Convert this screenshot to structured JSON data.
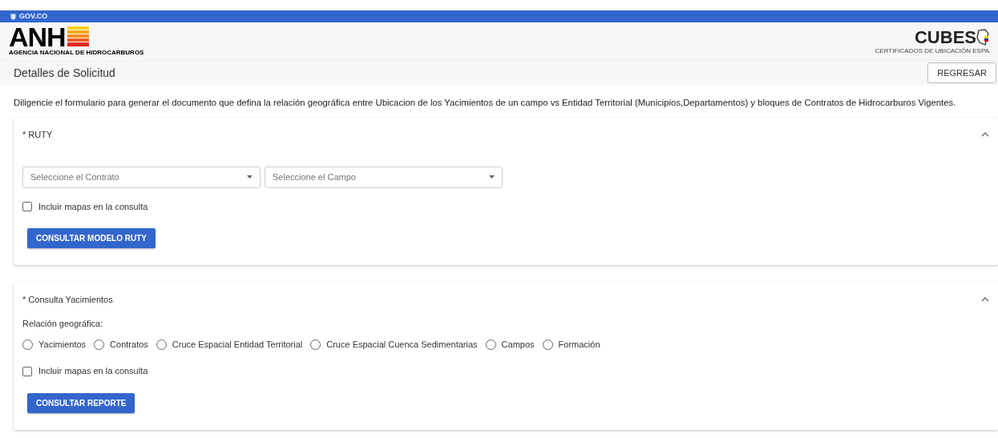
{
  "gov_bar": {
    "label": "GOV.CO"
  },
  "header": {
    "logo_left": {
      "text": "ANH",
      "subtitle": "AGENCIA NACIONAL DE HIDROCARBUROS"
    },
    "logo_right": {
      "text": "CUBES",
      "subtitle": "CERTIFICADOS DE UBICACIÓN ESPA"
    }
  },
  "title_bar": {
    "title": "Detalles de Solicitud",
    "button": "REGRESAR"
  },
  "description": "Diligencie el formulario para generar el documento que defina la relación geográfica entre Ubicacion de los Yacimientos de un campo vs Entidad Territorial (Municipios,Departamentos) y bloques de Contratos de Hidrocarburos Vigentes.",
  "panels": [
    {
      "title": "* RUTY",
      "expanded": true,
      "selects": [
        {
          "placeholder": "Seleccione el Contrato"
        },
        {
          "placeholder": "Seleccione el Campo"
        }
      ],
      "checkbox": {
        "label": "Incluir mapas en la consulta",
        "checked": false
      },
      "button": "CONSULTAR MODELO RUTY"
    },
    {
      "title": "* Consulta Yacimientos",
      "expanded": true,
      "radio_label": "Relación geográfica:",
      "radios": [
        {
          "label": "Yacimientos",
          "selected": false
        },
        {
          "label": "Contratos",
          "selected": false
        },
        {
          "label": "Cruce Espacial Entidad Territorial",
          "selected": false
        },
        {
          "label": "Cruce Espacial Cuenca Sedimentarias",
          "selected": false
        },
        {
          "label": "Campos",
          "selected": false
        },
        {
          "label": "Formación",
          "selected": false
        }
      ],
      "checkbox": {
        "label": "Incluir mapas en la consulta",
        "checked": false
      },
      "button": "CONSULTAR REPORTE"
    }
  ]
}
